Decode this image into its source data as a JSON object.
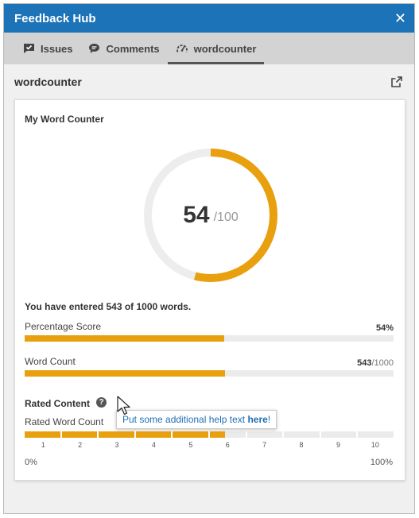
{
  "window": {
    "title": "Feedback Hub"
  },
  "tabs": [
    {
      "label": "Issues",
      "icon": "message-check-icon",
      "active": false
    },
    {
      "label": "Comments",
      "icon": "comment-icon",
      "active": false
    },
    {
      "label": "wordcounter",
      "icon": "gauge-icon",
      "active": true
    }
  ],
  "section": {
    "title": "wordcounter"
  },
  "card": {
    "title": "My Word Counter",
    "score": {
      "value": "54",
      "max": "/100",
      "fraction": 0.54
    },
    "summary": "You have entered 543 of 1000 words.",
    "percentage": {
      "label": "Percentage Score",
      "value": "54%",
      "fraction": 0.54
    },
    "word_count": {
      "label": "Word Count",
      "value": "543",
      "max": "/1000",
      "fraction": 0.543
    },
    "rated": {
      "title": "Rated Content",
      "subtitle": "Rated Word Count",
      "ticks": [
        "1",
        "2",
        "3",
        "4",
        "5",
        "6",
        "7",
        "8",
        "9",
        "10"
      ],
      "level": 5.43,
      "min_label": "0%",
      "max_label": "100%"
    },
    "tooltip": {
      "prefix": "Put some additional help text ",
      "link": "here",
      "suffix": "!"
    }
  },
  "colors": {
    "accent": "#e8a00e",
    "titlebar": "#1c73b8",
    "track": "#ebebeb",
    "link": "#1f6fb5"
  }
}
